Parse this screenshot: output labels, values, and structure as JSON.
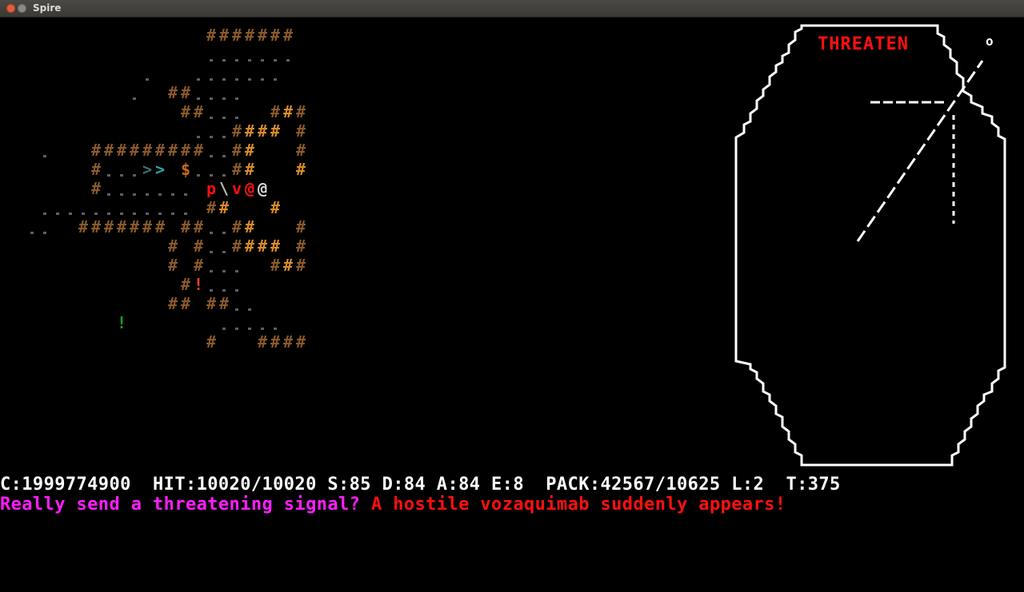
{
  "window": {
    "title": "Spire"
  },
  "panel": {
    "title": "THREATEN",
    "corner_glyph": "o"
  },
  "status": {
    "text": "C:1999774900  HIT:10020/10020 S:85 D:84 A:84 E:8  PACK:42567/10625 L:2  T:375"
  },
  "messages": {
    "prompt": "Really send a threatening signal?",
    "event": "A hostile vozaquimab suddenly appears!"
  },
  "colors": {
    "wall_dark": "#8a5a2b",
    "wall_lit": "#d98c2a",
    "floor": "#5e5e5e",
    "player": "#d8d8d8",
    "enemy": "#ff1010",
    "stairs": "#2aa7a7",
    "gold": "#c96a1e",
    "potion_red": "#e8451b",
    "potion_green": "#1aa31a",
    "panel_line": "#ffffff"
  },
  "map": {
    "symbols": {
      "wall": "#",
      "stairs_down": ">",
      "gold": "$",
      "monster_p": "p",
      "monster_v": "v",
      "player": "@",
      "companion": "@",
      "weapon": "\\",
      "potion": "!"
    }
  }
}
